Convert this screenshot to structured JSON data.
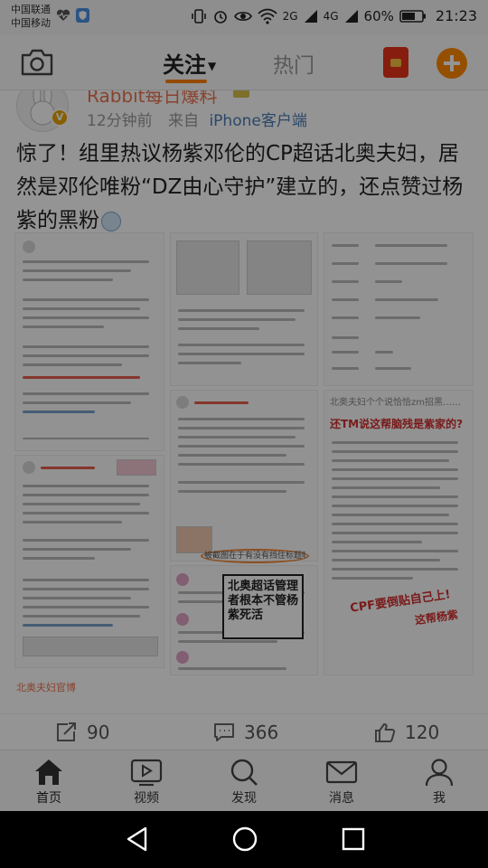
{
  "status_bar": {
    "carrier_1": "中国联通",
    "carrier_2": "中国移动",
    "battery_percent": "60%",
    "time": "21:23",
    "network_1": "2G",
    "network_2": "4G"
  },
  "top_nav": {
    "tab_follow": "关注",
    "tab_hot": "热门",
    "accent_color": "#ff8200"
  },
  "post": {
    "author": "Rabbit每日爆料",
    "time_ago": "12分钟前",
    "source_prefix": "来自",
    "source": "iPhone客户端",
    "text": "惊了！组里热议杨紫邓伦的CP超话北奥夫妇，居然是邓伦唯粉“DZ由心守护”建立的，还点赞过杨紫的黑粉",
    "image_texts": {
      "callout": "北奥超话管理者根本不管杨紫死活",
      "circled_note": "被截图在于有没有挡住标题呢",
      "right_top_1": "北奥夫妇个个说恰恰zm招黑……",
      "right_headline": "还TM说这帮脑残是紫家的?",
      "bottom_banner": "CPF要倒贴自己上!",
      "bottom_banner_2": "这帮杨紫"
    },
    "next_author": "北奥夫妇官博",
    "actions": {
      "repost_count": "90",
      "comment_count": "366",
      "like_count": "120"
    }
  },
  "bottom_tabs": [
    {
      "label": "首页",
      "icon": "home-icon"
    },
    {
      "label": "视频",
      "icon": "video-icon"
    },
    {
      "label": "发现",
      "icon": "discover-icon"
    },
    {
      "label": "消息",
      "icon": "message-icon"
    },
    {
      "label": "我",
      "icon": "profile-icon"
    }
  ],
  "android_nav": {
    "back": "back-icon",
    "home": "home-circle-icon",
    "recents": "recents-icon"
  }
}
